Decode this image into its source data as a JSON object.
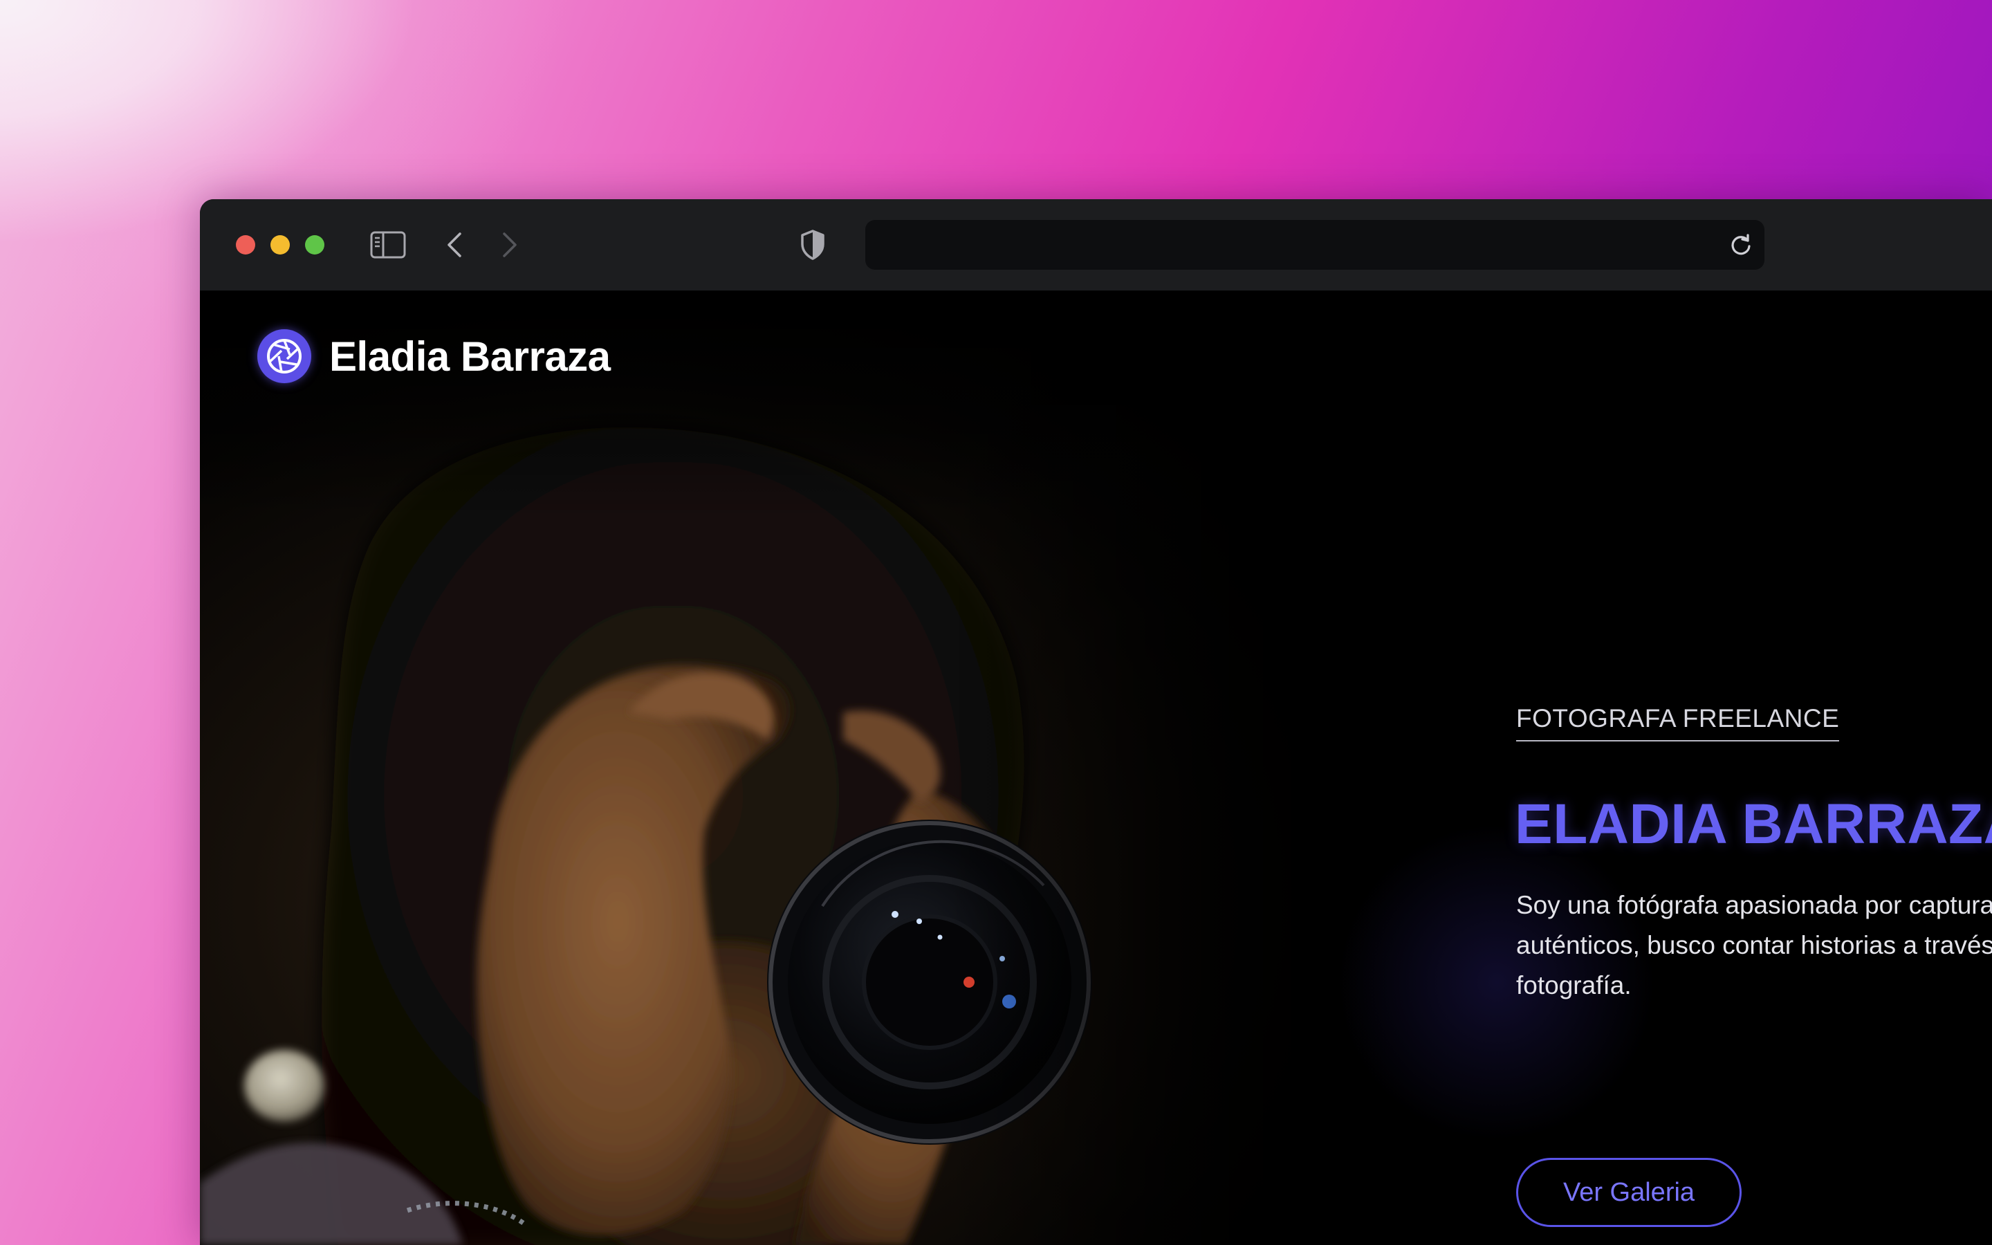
{
  "browser": {
    "url": "",
    "controls": {
      "close": "close",
      "minimize": "minimize",
      "zoom": "zoom"
    },
    "icons": [
      "sidebar-icon",
      "chevron-left-icon",
      "chevron-right-icon",
      "shield-icon",
      "reload-icon"
    ]
  },
  "site": {
    "logo_text": "Eladia Barraza",
    "logo_icon": "camera-aperture-icon"
  },
  "hero": {
    "eyebrow": "FOTOGRAFA FREELANCE",
    "title": "ELADIA BARRAZA",
    "description": "Soy una fotógrafa apasionada por capturar momentos auténticos, busco contar historias a través de la belleza de la fotografía.",
    "cta_label": "Ver Galeria"
  },
  "colors": {
    "accent": "#6560f2",
    "logo_badge": "#5b4ee6",
    "page_bg": "#000000",
    "toolbar_bg": "#1c1d1f"
  }
}
